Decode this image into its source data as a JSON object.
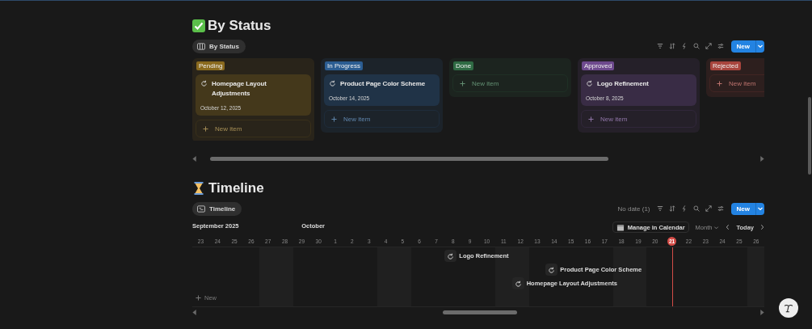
{
  "board_section": {
    "title": "By Status",
    "view_tab": {
      "label": "By Status",
      "selected": true
    },
    "new_button": "New",
    "columns": [
      {
        "label": "Pending",
        "color": "#8a6a1e",
        "cards": [
          {
            "title": "Homepage Layout Adjustments",
            "date": "October 12, 2025"
          }
        ],
        "new_item": "New item"
      },
      {
        "label": "In Progress",
        "color": "#2b5d92",
        "cards": [
          {
            "title": "Product Page Color Scheme",
            "date": "October 14, 2025"
          }
        ],
        "new_item": "New item"
      },
      {
        "label": "Done",
        "color": "#2f6b44",
        "new_item": "New item"
      },
      {
        "label": "Approved",
        "color": "#6e4a8e",
        "cards": [
          {
            "title": "Logo Refinement",
            "date": "October 8, 2025"
          }
        ],
        "new_item": "New item"
      },
      {
        "label": "Rejected",
        "color": "#a8453d",
        "new_item": "New item"
      }
    ]
  },
  "timeline_section": {
    "title": "Timeline",
    "view_tab": {
      "label": "Timeline",
      "selected": true
    },
    "no_date": "No date (1)",
    "new_button": "New",
    "manage_button": "Manage in Calendar",
    "range_select": "Month",
    "today_button": "Today",
    "months": [
      "September 2025",
      "October"
    ],
    "days": [
      {
        "label": "23",
        "weekend": false,
        "today": false
      },
      {
        "label": "24",
        "weekend": false,
        "today": false
      },
      {
        "label": "25",
        "weekend": false,
        "today": false
      },
      {
        "label": "26",
        "weekend": false,
        "today": false
      },
      {
        "label": "27",
        "weekend": true,
        "today": false
      },
      {
        "label": "28",
        "weekend": true,
        "today": false
      },
      {
        "label": "29",
        "weekend": false,
        "today": false
      },
      {
        "label": "30",
        "weekend": false,
        "today": false
      },
      {
        "label": "1",
        "weekend": false,
        "today": false
      },
      {
        "label": "2",
        "weekend": false,
        "today": false
      },
      {
        "label": "3",
        "weekend": false,
        "today": false
      },
      {
        "label": "4",
        "weekend": true,
        "today": false
      },
      {
        "label": "5",
        "weekend": true,
        "today": false
      },
      {
        "label": "6",
        "weekend": false,
        "today": false
      },
      {
        "label": "7",
        "weekend": false,
        "today": false
      },
      {
        "label": "8",
        "weekend": false,
        "today": false
      },
      {
        "label": "9",
        "weekend": false,
        "today": false
      },
      {
        "label": "10",
        "weekend": false,
        "today": false
      },
      {
        "label": "11",
        "weekend": true,
        "today": false
      },
      {
        "label": "12",
        "weekend": true,
        "today": false
      },
      {
        "label": "13",
        "weekend": false,
        "today": false
      },
      {
        "label": "14",
        "weekend": false,
        "today": false
      },
      {
        "label": "15",
        "weekend": false,
        "today": false
      },
      {
        "label": "16",
        "weekend": false,
        "today": false
      },
      {
        "label": "17",
        "weekend": false,
        "today": false
      },
      {
        "label": "18",
        "weekend": true,
        "today": false
      },
      {
        "label": "19",
        "weekend": true,
        "today": false
      },
      {
        "label": "20",
        "weekend": false,
        "today": false
      },
      {
        "label": "21",
        "weekend": false,
        "today": true
      },
      {
        "label": "22",
        "weekend": false,
        "today": false
      },
      {
        "label": "23",
        "weekend": false,
        "today": false
      },
      {
        "label": "24",
        "weekend": false,
        "today": false
      },
      {
        "label": "25",
        "weekend": false,
        "today": false
      },
      {
        "label": "26",
        "weekend": true,
        "today": false
      }
    ],
    "items": [
      {
        "title": "Logo Refinement"
      },
      {
        "title": "Product Page Color Scheme"
      },
      {
        "title": "Homepage Layout Adjustments"
      }
    ],
    "new_row": "New"
  }
}
